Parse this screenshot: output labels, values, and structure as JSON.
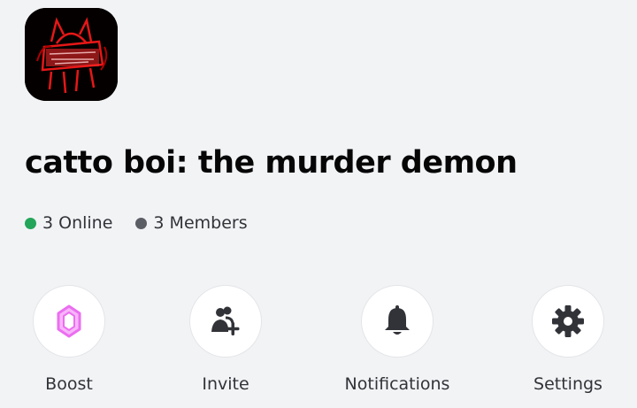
{
  "server": {
    "name": "catto boi: the murder demon",
    "icon": "server-avatar-red-demon-image"
  },
  "stats": {
    "online_text": "3 Online",
    "members_text": "3 Members",
    "online_color": "#23a55a",
    "members_color": "#5c5e66"
  },
  "actions": [
    {
      "label": "Boost",
      "icon": "boost-gem-icon",
      "color": "#eb6ef0"
    },
    {
      "label": "Invite",
      "icon": "invite-user-plus-icon",
      "color": "#313338"
    },
    {
      "label": "Notifications",
      "icon": "bell-icon",
      "color": "#313338"
    },
    {
      "label": "Settings",
      "icon": "gear-icon",
      "color": "#313338"
    }
  ]
}
